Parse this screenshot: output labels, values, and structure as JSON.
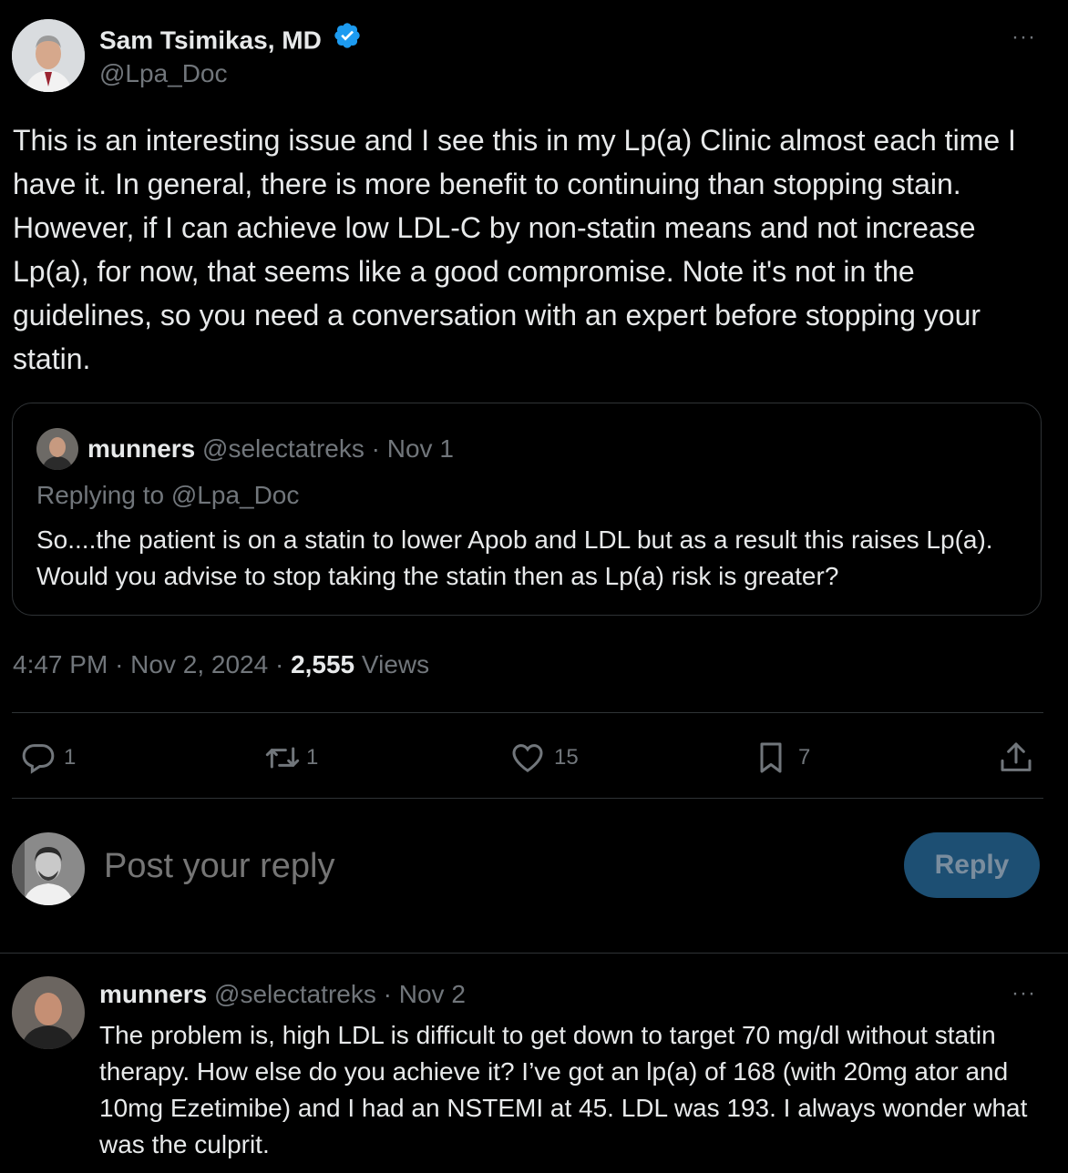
{
  "tweet": {
    "author_name": "Sam Tsimikas, MD",
    "author_handle": "@Lpa_Doc",
    "text": "This is an interesting issue and I see this in my Lp(a) Clinic almost each time I have it. In general, there is more benefit to continuing than stopping stain. However, if I can achieve low LDL-C by non-statin means and not increase Lp(a), for now, that seems like a good compromise. Note it's not in the guidelines, so you need a conversation with an expert before stopping your statin.",
    "time": "4:47 PM",
    "date": "Nov 2, 2024",
    "views_count": "2,555",
    "views_label": "Views",
    "more_label": "···"
  },
  "quote": {
    "author_name": "munners",
    "author_handle": "@selectatreks",
    "date": "Nov 1",
    "replying_to_prefix": "Replying to",
    "replying_to_handle": "@Lpa_Doc",
    "text": "So....the patient is on a statin to lower Apob and LDL but as a result this raises Lp(a). Would you advise to stop taking the statin then as Lp(a) risk is greater?"
  },
  "actions": {
    "replies": "1",
    "reposts": "1",
    "likes": "15",
    "bookmarks": "7"
  },
  "composer": {
    "placeholder": "Post your reply",
    "button_label": "Reply"
  },
  "reply": {
    "author_name": "munners",
    "author_handle": "@selectatreks",
    "date": "Nov 2",
    "text": "The problem is, high LDL is difficult to get down to target 70 mg/dl without statin therapy. How else do you achieve it? I’ve got an lp(a) of 168 (with 20mg ator and 10mg Ezetimibe) and I had an NSTEMI at 45. LDL was 193. I always wonder what was the culprit.",
    "more_label": "···"
  },
  "separator": "·",
  "colors": {
    "background": "#000000",
    "text": "#e7e9ea",
    "muted": "#71767b",
    "border": "#2f3336",
    "verified": "#1d9bf0",
    "reply_button": "#1d4f73"
  }
}
